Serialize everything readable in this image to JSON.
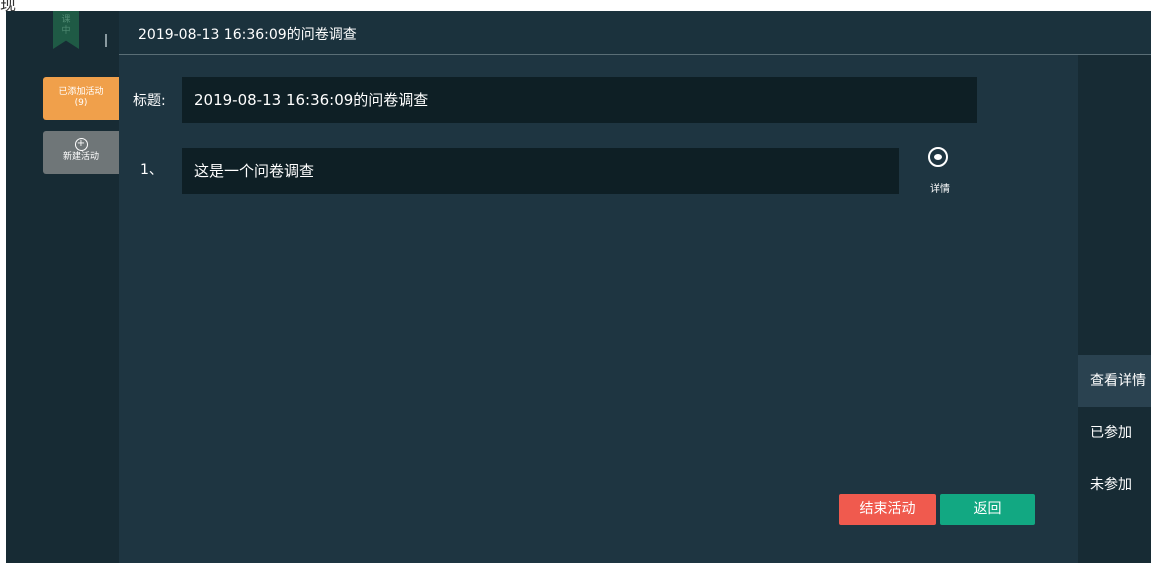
{
  "stray_text": "现",
  "sidebar": {
    "logo_text": "课\n中",
    "added_activities_label": "已添加活动",
    "added_activities_count": "(9)",
    "new_activity_icon": "plus-circle",
    "new_activity_label": "新建活动"
  },
  "header": {
    "title": "2019-08-13 16:36:09的问卷调查"
  },
  "form": {
    "title_label": "标题:",
    "title_value": "2019-08-13 16:36:09的问卷调查",
    "questions": [
      {
        "index": "1、",
        "text": "这是一个问卷调查",
        "detail_icon": "eye",
        "detail_label": "详情"
      }
    ]
  },
  "buttons": {
    "end_activity": "结束活动",
    "back": "返回"
  },
  "right_panel": {
    "items": [
      {
        "label": "查看详情",
        "active": true
      },
      {
        "label": "已参加",
        "active": false
      },
      {
        "label": "未参加",
        "active": false
      }
    ]
  },
  "colors": {
    "background": "#1e3541",
    "sidebar": "#172b34",
    "field": "#0e1f25",
    "added_button": "#f0a04b",
    "new_button": "#6f7678",
    "end_button": "#f05a4e",
    "back_button": "#12a882"
  }
}
